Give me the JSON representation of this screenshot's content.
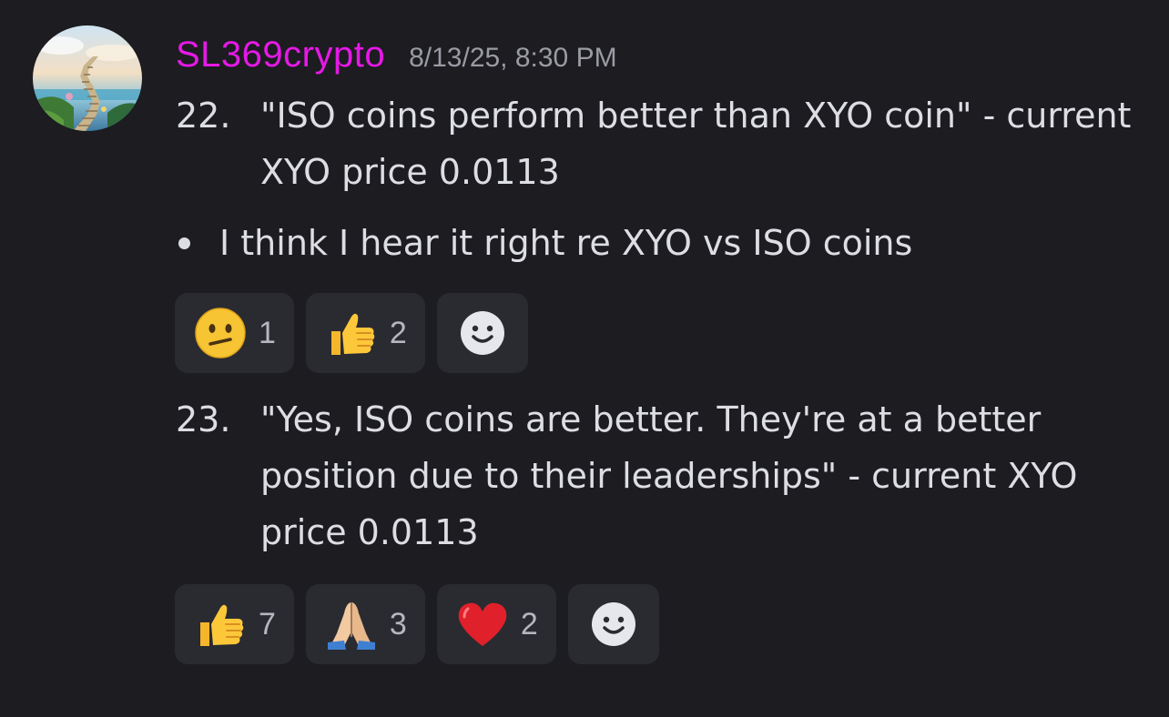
{
  "message": {
    "username": "SL369crypto",
    "timestamp": "8/13/25, 8:30 PM",
    "item_22": {
      "number": "22.",
      "text": "\"ISO coins perform better than XYO coin\" - current XYO price 0.0113"
    },
    "bullet": "I think I hear it right re XYO vs ISO coins",
    "item_23": {
      "number": "23.",
      "text": "\"Yes, ISO coins are better. They're at a better position due to their leaderships\" - current XYO price 0.0113"
    }
  },
  "reactions_1": [
    {
      "icon": "confused-face-icon",
      "count": "1"
    },
    {
      "icon": "thumbs-up-icon",
      "count": "2"
    },
    {
      "icon": "add-reaction-smiley-icon"
    }
  ],
  "reactions_2": [
    {
      "icon": "thumbs-up-icon",
      "count": "7"
    },
    {
      "icon": "folded-hands-icon",
      "count": "3"
    },
    {
      "icon": "red-heart-icon",
      "count": "2"
    },
    {
      "icon": "add-reaction-smiley-icon"
    }
  ],
  "colors": {
    "background": "#1c1c21",
    "username": "#e619e6",
    "timestamp": "#9a9ba3",
    "text": "#dddee3",
    "reaction_bg": "#2a2b31"
  }
}
